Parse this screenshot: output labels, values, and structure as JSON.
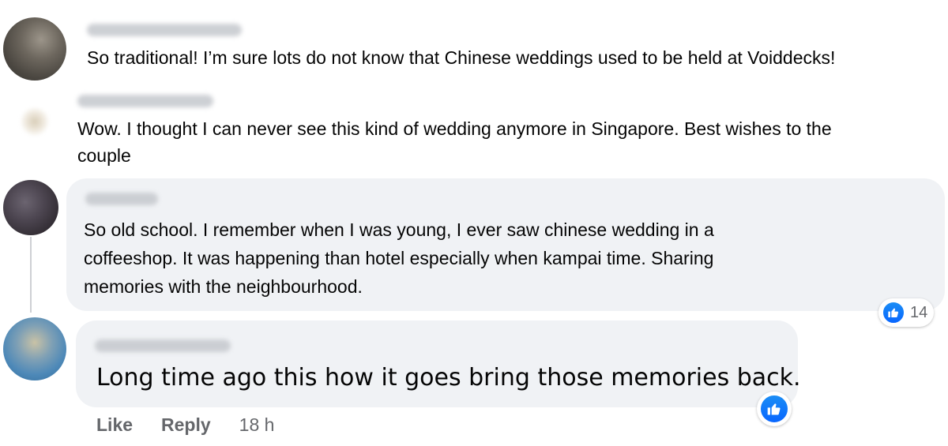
{
  "comments": [
    {
      "text": "So traditional! I’m sure lots do not know that Chinese weddings used to be held at Voiddecks!"
    },
    {
      "text_line1": "Wow. I thought I can never see this kind of wedding anymore in Singapore. Best wishes to the",
      "text_line2": "couple"
    },
    {
      "text_line1": "So old school. I remember when I was young, I ever saw chinese wedding in a",
      "text_line2": "coffeeshop. It was happening than hotel especially when kampai time. Sharing",
      "text_line3": "memories with the neighbourhood.",
      "reaction_count": "14"
    },
    {
      "text": "Long time ago this how it goes bring those memories back.",
      "actions": {
        "like_label": "Like",
        "reply_label": "Reply",
        "timestamp": "18 h"
      }
    }
  ],
  "colors": {
    "bubble": "#f0f2f5",
    "like_blue": "#0866ff",
    "secondary_text": "#65676b"
  },
  "icons": {
    "reaction": "thumbs-up-icon"
  }
}
